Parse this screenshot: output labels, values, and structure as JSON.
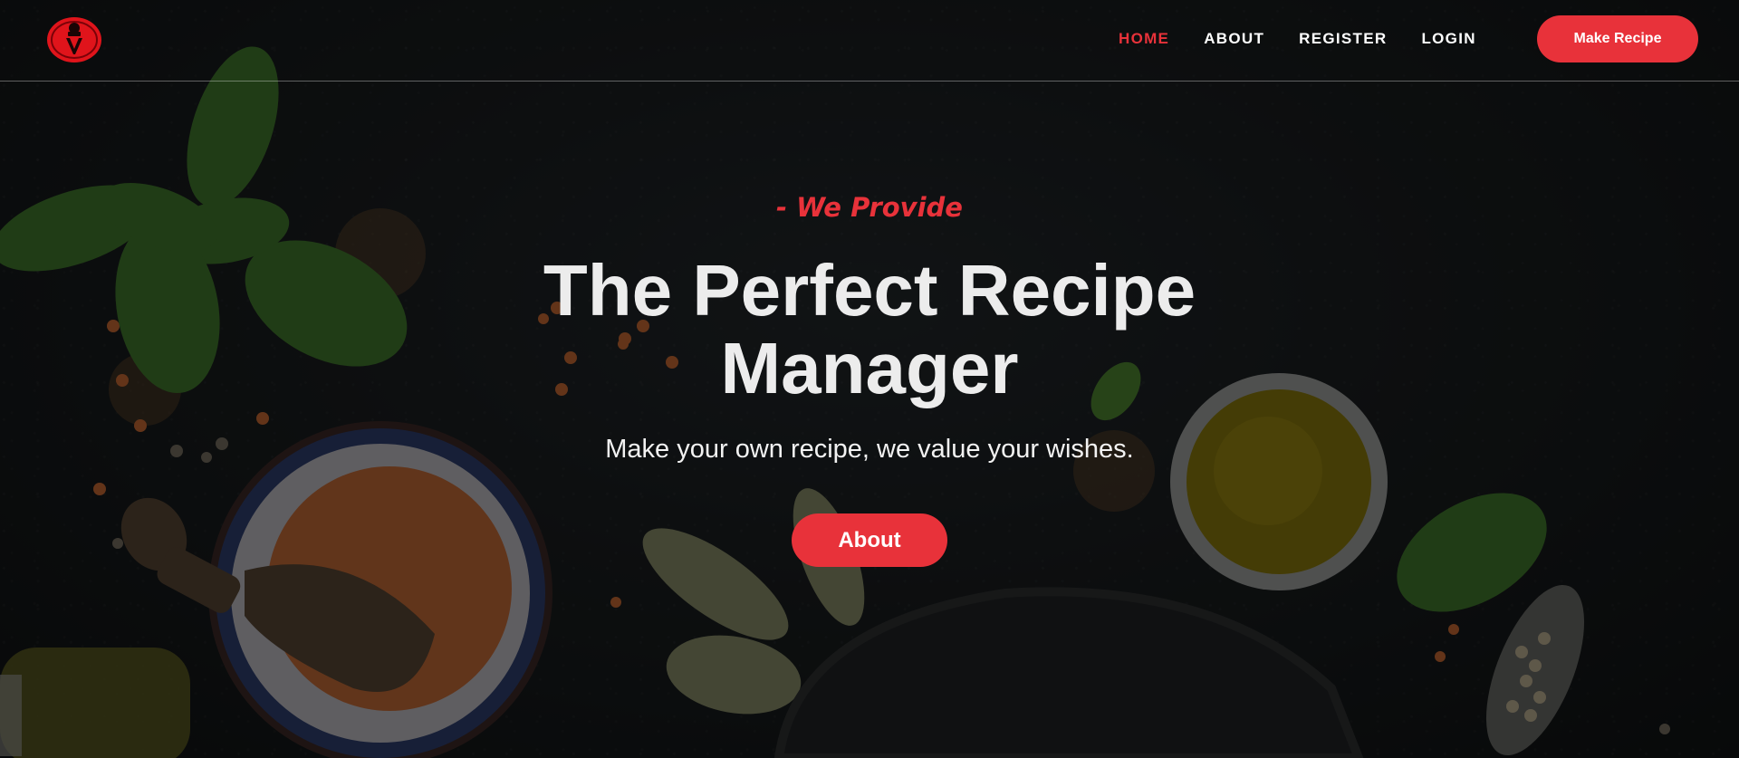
{
  "brand": {
    "logo_icon": "chef-hat-icon",
    "accent_color": "#e8323a"
  },
  "nav": {
    "items": [
      {
        "label": "HOME",
        "active": true
      },
      {
        "label": "ABOUT",
        "active": false
      },
      {
        "label": "REGISTER",
        "active": false
      },
      {
        "label": "LOGIN",
        "active": false
      }
    ],
    "cta_label": "Make Recipe"
  },
  "hero": {
    "kicker": "- We Provide",
    "title": "The Perfect Recipe Manager",
    "subtitle": "Make your own recipe, we value your wishes.",
    "button_label": "About"
  }
}
